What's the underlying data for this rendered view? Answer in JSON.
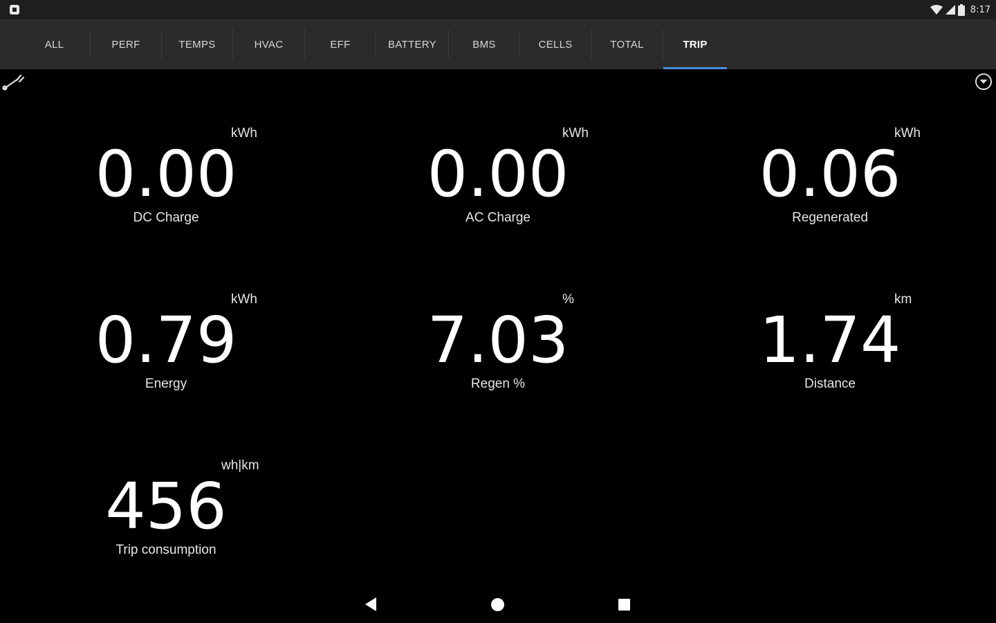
{
  "status_bar": {
    "time": "8:17",
    "icons": [
      "notification-icon",
      "wifi-icon",
      "signal-icon",
      "battery-icon"
    ]
  },
  "tabs": [
    {
      "label": "ALL",
      "active": false
    },
    {
      "label": "PERF",
      "active": false
    },
    {
      "label": "TEMPS",
      "active": false
    },
    {
      "label": "HVAC",
      "active": false
    },
    {
      "label": "EFF",
      "active": false
    },
    {
      "label": "BATTERY",
      "active": false
    },
    {
      "label": "BMS",
      "active": false
    },
    {
      "label": "CELLS",
      "active": false
    },
    {
      "label": "TOTAL",
      "active": false
    },
    {
      "label": "TRIP",
      "active": true
    }
  ],
  "toolbar": {
    "settings_icon": "wrench-icon",
    "menu_icon": "chevron-down-circle-icon"
  },
  "gauges": [
    {
      "unit": "kWh",
      "value": "0.00",
      "label": "DC Charge"
    },
    {
      "unit": "kWh",
      "value": "0.00",
      "label": "AC Charge"
    },
    {
      "unit": "kWh",
      "value": "0.06",
      "label": "Regenerated"
    },
    {
      "unit": "kWh",
      "value": "0.79",
      "label": "Energy"
    },
    {
      "unit": "%",
      "value": "7.03",
      "label": "Regen %"
    },
    {
      "unit": "km",
      "value": "1.74",
      "label": "Distance"
    },
    {
      "unit": "wh|km",
      "value": "456",
      "label": "Trip consumption"
    }
  ],
  "nav_bar": {
    "icons": [
      "back-icon",
      "home-icon",
      "recents-icon"
    ]
  },
  "colors": {
    "background": "#000000",
    "tab_bar": "#2b2b2b",
    "status_bar": "#1e1e1e",
    "accent": "#4a90e2",
    "text": "#ffffff"
  }
}
